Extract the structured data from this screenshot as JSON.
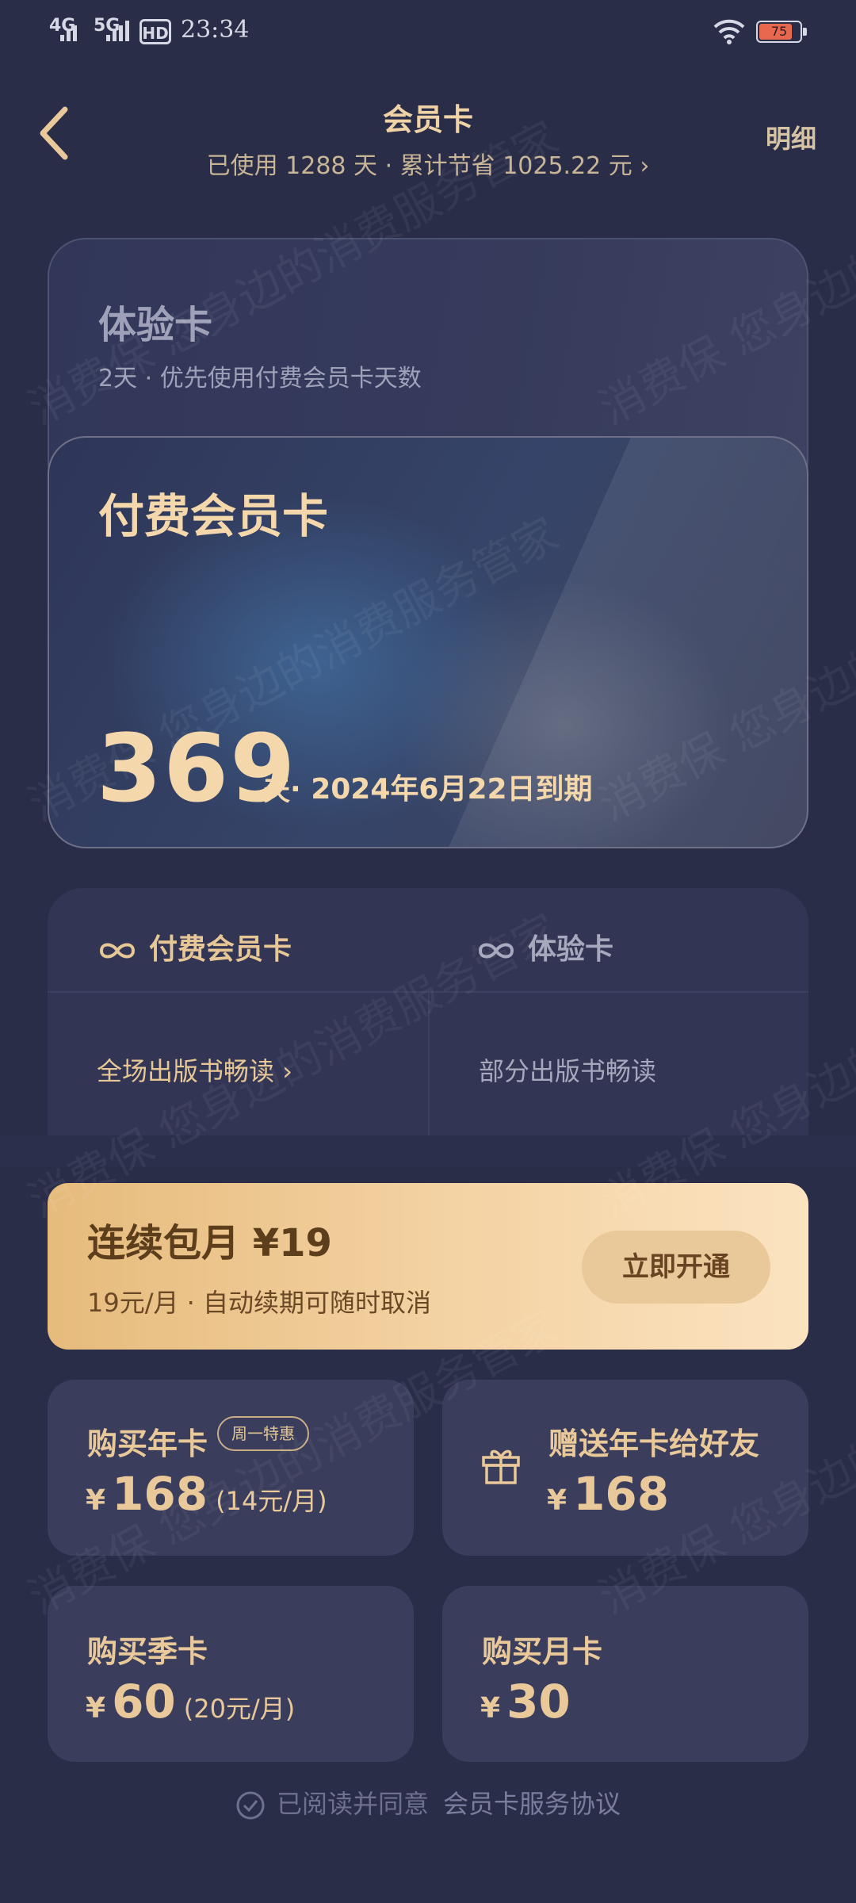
{
  "status_bar": {
    "network_1": "4G",
    "network_2": "5G",
    "hd": "HD",
    "time": "23:34",
    "battery": "75"
  },
  "header": {
    "title": "会员卡",
    "detail_label": "明细",
    "stats": "已使用 1288 天 · 累计节省 1025.22 元"
  },
  "trial_card": {
    "title": "体验卡",
    "subtitle": "2天 · 优先使用付费会员卡天数"
  },
  "paid_card": {
    "title": "付费会员卡",
    "days": "369",
    "days_unit": "天",
    "expiry": "· 2024年6月22日到期"
  },
  "comparison": {
    "paid_label": "付费会员卡",
    "trial_label": "体验卡",
    "paid_benefit": "全场出版书畅读",
    "trial_benefit": "部分出版书畅读"
  },
  "monthly": {
    "title": "连续包月",
    "price": "¥19",
    "subtitle": "19元/月 · 自动续期可随时取消",
    "button": "立即开通"
  },
  "tiles": {
    "year": {
      "title": "购买年卡",
      "badge": "周一特惠",
      "price": "168",
      "per": "(14元/月)"
    },
    "gift_year": {
      "title": "赠送年卡给好友",
      "price": "168"
    },
    "quarter": {
      "title": "购买季卡",
      "price": "60",
      "per": "(20元/月)"
    },
    "month": {
      "title": "购买月卡",
      "price": "30"
    },
    "currency": "¥"
  },
  "agreement": {
    "text": "已阅读并同意",
    "link": "会员卡服务协议"
  },
  "watermark": "消费保 您身边的消费服务管家",
  "colors": {
    "background": "#2a2d48",
    "gold": "#e9c899",
    "banner_start": "#e6bb7c",
    "banner_end": "#fbe3c0"
  }
}
